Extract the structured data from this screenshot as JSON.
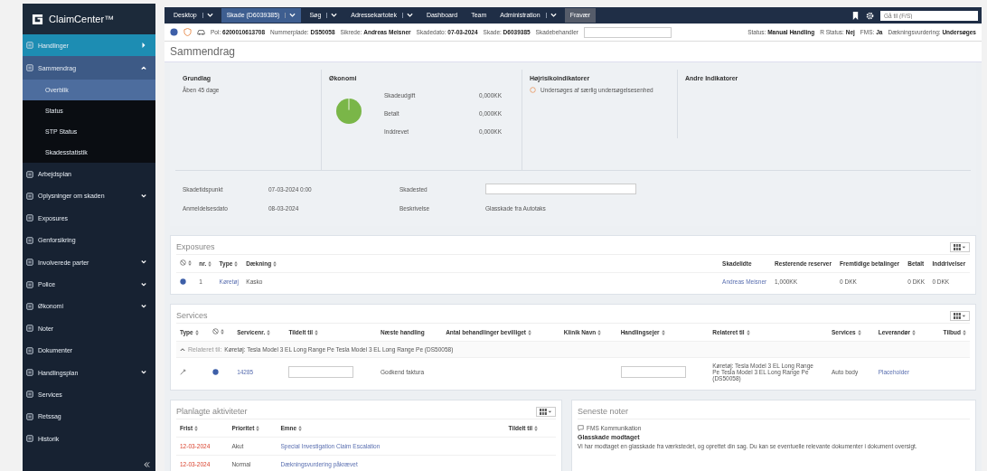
{
  "brand": {
    "name": "ClaimCenter™"
  },
  "nav": {
    "tabs": [
      {
        "label": "Desktop",
        "menu": true,
        "selected": false,
        "kind": "tab"
      },
      {
        "label": "Skade (D6039385)",
        "menu": true,
        "selected": true,
        "kind": "tab"
      },
      {
        "label": "Søg",
        "menu": true,
        "selected": false,
        "kind": "tab"
      },
      {
        "label": "Adressekartotek",
        "menu": true,
        "selected": false,
        "kind": "tab"
      },
      {
        "label": "Dashboard",
        "menu": false,
        "selected": false,
        "kind": "tab"
      },
      {
        "label": "Team",
        "menu": false,
        "selected": false,
        "kind": "tab"
      },
      {
        "label": "Administration",
        "menu": true,
        "selected": false,
        "kind": "tab"
      },
      {
        "label": "Fravær",
        "menu": false,
        "selected": false,
        "kind": "special"
      }
    ],
    "search": {
      "placeholder": "Gå til (F/S)"
    }
  },
  "sidebar": {
    "items": [
      {
        "label": "Handlinger",
        "kind": "action",
        "selected": false
      },
      {
        "label": "Sammendrag",
        "kind": "group",
        "selected": false,
        "expanded": true,
        "children": [
          {
            "label": "Overblik",
            "selected": true
          },
          {
            "label": "Status",
            "selected": false
          },
          {
            "label": "STP Status",
            "selected": false
          },
          {
            "label": "Skadesstatistik",
            "selected": false
          }
        ]
      },
      {
        "label": "Arbejdsplan",
        "kind": "link",
        "selected": false
      },
      {
        "label": "Oplysninger om skaden",
        "kind": "group",
        "selected": false,
        "expanded": false
      },
      {
        "label": "Exposures",
        "kind": "link",
        "selected": false
      },
      {
        "label": "Genforsikring",
        "kind": "link",
        "selected": false
      },
      {
        "label": "Involverede parter",
        "kind": "group",
        "selected": false,
        "expanded": false
      },
      {
        "label": "Police",
        "kind": "group",
        "selected": false,
        "expanded": false
      },
      {
        "label": "Økonomi",
        "kind": "group",
        "selected": false,
        "expanded": false
      },
      {
        "label": "Noter",
        "kind": "link",
        "selected": false
      },
      {
        "label": "Dokumenter",
        "kind": "link",
        "selected": false
      },
      {
        "label": "Handlingsplan",
        "kind": "group",
        "selected": false,
        "expanded": false
      },
      {
        "label": "Services",
        "kind": "link",
        "selected": false
      },
      {
        "label": "Retssag",
        "kind": "link",
        "selected": false
      },
      {
        "label": "Historik",
        "kind": "link",
        "selected": false
      }
    ]
  },
  "info_bar": {
    "fields": [
      {
        "label": "Pol:",
        "value": "6200010613708"
      },
      {
        "label": "Nummerplade:",
        "value": "DS50058"
      },
      {
        "label": "Sikrede:",
        "value": "Andreas Meisner"
      },
      {
        "label": "Skadedato:",
        "value": "07-03-2024"
      },
      {
        "label": "Skade:",
        "value": "D6039385"
      }
    ],
    "handler_label": "Skadebehandler",
    "statuses": [
      {
        "label": "Status:",
        "value": "Manual Handling"
      },
      {
        "label": "R Status:",
        "value": "Nej"
      },
      {
        "label": "FMS:",
        "value": "Ja"
      },
      {
        "label": "Dækningsvurdering:",
        "value": "Undersøges"
      }
    ]
  },
  "page_title": "Sammendrag",
  "summary": {
    "grundlag": {
      "title": "Grundlag",
      "text": "Åben 45 dage"
    },
    "okonomi": {
      "title": "Økonomi",
      "rows": [
        {
          "label": "Skadeudgift",
          "value": "0,000KK"
        },
        {
          "label": "Betalt",
          "value": "0,000KK"
        },
        {
          "label": "Inddrevet",
          "value": "0,000KK"
        }
      ]
    },
    "high_risk": {
      "title": "Højrisikoindikatorer",
      "items": [
        "Undersøges af særlig undersøgelsesenhed"
      ]
    },
    "other": {
      "title": "Andre Indikatorer"
    },
    "details": [
      {
        "label": "Skadetidspunkt",
        "value": "07-03-2024 0:00",
        "kind": "text"
      },
      {
        "label": "Skadested",
        "kind": "field"
      },
      {
        "label": "Anmeldelsesdato",
        "value": "08-03-2024",
        "kind": "text"
      },
      {
        "label": "Beskrivelse",
        "value": "Glasskade fra Autotaks",
        "kind": "text"
      }
    ]
  },
  "exposures": {
    "title": "Exposures",
    "columns": [
      {
        "kind": "icon",
        "sortable": true
      },
      {
        "label": "nr.",
        "sortable": true
      },
      {
        "label": "Type",
        "sortable": true
      },
      {
        "label": "Dækning",
        "sortable": true
      },
      {
        "label": "Skadelidte",
        "sortable": false
      },
      {
        "label": "Resterende reserver",
        "sortable": false
      },
      {
        "label": "Fremtidige betalinger",
        "sortable": false
      },
      {
        "label": "Betalt",
        "sortable": false
      },
      {
        "label": "Inddrivelser",
        "sortable": false
      }
    ],
    "rows": [
      [
        {
          "kind": "dot"
        },
        {
          "kind": "text",
          "text": "1"
        },
        {
          "kind": "link",
          "text": "Køretøj"
        },
        {
          "kind": "text",
          "text": "Kasko"
        },
        {
          "kind": "link",
          "text": "Andreas Meisner"
        },
        {
          "kind": "text",
          "text": "1,000KK"
        },
        {
          "kind": "text",
          "text": "0 DKK"
        },
        {
          "kind": "text",
          "text": "0 DKK"
        },
        {
          "kind": "text",
          "text": "0 DKK"
        }
      ]
    ]
  },
  "services": {
    "title": "Services",
    "columns": [
      {
        "label": "Type",
        "sortable": true
      },
      {
        "kind": "icon",
        "sortable": true
      },
      {
        "label": "Servicenr.",
        "sortable": true
      },
      {
        "label": "Tildelt til",
        "sortable": true
      },
      {
        "label": "Næste handling",
        "sortable": false
      },
      {
        "label": "Antal behandlinger bevilliget",
        "sortable": true
      },
      {
        "label": "Klinik Navn",
        "sortable": true
      },
      {
        "label": "Handlingsejer",
        "sortable": true
      },
      {
        "label": "Relateret til",
        "sortable": true
      },
      {
        "label": "Services",
        "sortable": true
      },
      {
        "label": "Leverandør",
        "sortable": true
      },
      {
        "label": "Tilbud",
        "sortable": true
      }
    ],
    "group": {
      "label": "Relateret til:",
      "value": "Køretøj: Tesla Model 3 EL Long Range Pe Tesla Model 3 EL Long Range Pe (DS50058)",
      "expanded": true
    },
    "rows": [
      [
        {
          "kind": "tool"
        },
        {
          "kind": "dot"
        },
        {
          "kind": "link",
          "text": "14285"
        },
        {
          "kind": "field"
        },
        {
          "kind": "text",
          "text": "Godkend faktura"
        },
        {
          "kind": "text",
          "text": ""
        },
        {
          "kind": "text",
          "text": ""
        },
        {
          "kind": "field"
        },
        {
          "kind": "wrap",
          "text": "Køretøj: Tesla Model 3 EL Long Range Pe Tesla Model 3 EL Long Range Pe (DS50058)"
        },
        {
          "kind": "text",
          "text": "Auto body"
        },
        {
          "kind": "link",
          "text": "Placeholder"
        },
        {
          "kind": "text",
          "text": ""
        }
      ]
    ]
  },
  "activities": {
    "title": "Planlagte aktiviteter",
    "columns": [
      {
        "label": "Frist",
        "sortable": true
      },
      {
        "label": "Prioritet",
        "sortable": true
      },
      {
        "label": "Emne",
        "sortable": true
      },
      {
        "label": "Tildelt til",
        "sortable": true
      }
    ],
    "rows": [
      {
        "due": "12-03-2024",
        "overdue": true,
        "priority": "Akut",
        "subject": "Special Investigation Claim Escalation"
      },
      {
        "due": "12-03-2024",
        "overdue": true,
        "priority": "Normal",
        "subject": "Dækningsvurdering påkrævet"
      }
    ]
  },
  "notes": {
    "title": "Seneste noter",
    "items": [
      {
        "category": "FMS Kommunikation",
        "title": "Glasskade modtaget",
        "body": "Vi har modtaget en glasskade fra værkstedet, og oprettet din sag. Du kan se eventuelle relevante dokumenter i dokument oversigt."
      }
    ]
  }
}
